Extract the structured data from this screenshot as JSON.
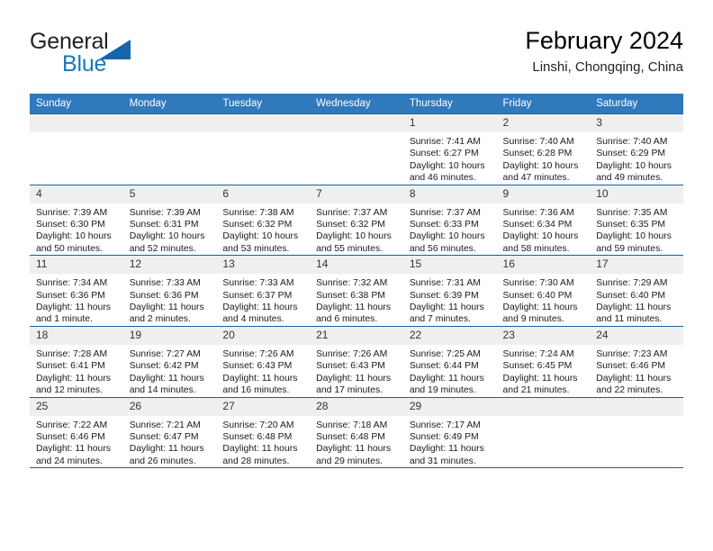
{
  "logo": {
    "word_top": "General",
    "word_bottom": "Blue",
    "triangle_color": "#1565ad",
    "blue_text_color": "#1878be"
  },
  "header": {
    "title": "February 2024",
    "subtitle": "Linshi, Chongqing, China"
  },
  "theme": {
    "header_blue": "#3079bd",
    "row_divider_blue": "#1b5fa0",
    "daynum_bg": "#efefef"
  },
  "calendar": {
    "weekday_headers": [
      "Sunday",
      "Monday",
      "Tuesday",
      "Wednesday",
      "Thursday",
      "Friday",
      "Saturday"
    ],
    "weeks": [
      [
        {
          "day": "",
          "sunrise": "",
          "sunset": "",
          "daylight_line1": "",
          "daylight_line2": "",
          "empty": true
        },
        {
          "day": "",
          "sunrise": "",
          "sunset": "",
          "daylight_line1": "",
          "daylight_line2": "",
          "empty": true
        },
        {
          "day": "",
          "sunrise": "",
          "sunset": "",
          "daylight_line1": "",
          "daylight_line2": "",
          "empty": true
        },
        {
          "day": "",
          "sunrise": "",
          "sunset": "",
          "daylight_line1": "",
          "daylight_line2": "",
          "empty": true
        },
        {
          "day": "1",
          "sunrise": "Sunrise: 7:41 AM",
          "sunset": "Sunset: 6:27 PM",
          "daylight_line1": "Daylight: 10 hours",
          "daylight_line2": "and 46 minutes."
        },
        {
          "day": "2",
          "sunrise": "Sunrise: 7:40 AM",
          "sunset": "Sunset: 6:28 PM",
          "daylight_line1": "Daylight: 10 hours",
          "daylight_line2": "and 47 minutes."
        },
        {
          "day": "3",
          "sunrise": "Sunrise: 7:40 AM",
          "sunset": "Sunset: 6:29 PM",
          "daylight_line1": "Daylight: 10 hours",
          "daylight_line2": "and 49 minutes."
        }
      ],
      [
        {
          "day": "4",
          "sunrise": "Sunrise: 7:39 AM",
          "sunset": "Sunset: 6:30 PM",
          "daylight_line1": "Daylight: 10 hours",
          "daylight_line2": "and 50 minutes."
        },
        {
          "day": "5",
          "sunrise": "Sunrise: 7:39 AM",
          "sunset": "Sunset: 6:31 PM",
          "daylight_line1": "Daylight: 10 hours",
          "daylight_line2": "and 52 minutes."
        },
        {
          "day": "6",
          "sunrise": "Sunrise: 7:38 AM",
          "sunset": "Sunset: 6:32 PM",
          "daylight_line1": "Daylight: 10 hours",
          "daylight_line2": "and 53 minutes."
        },
        {
          "day": "7",
          "sunrise": "Sunrise: 7:37 AM",
          "sunset": "Sunset: 6:32 PM",
          "daylight_line1": "Daylight: 10 hours",
          "daylight_line2": "and 55 minutes."
        },
        {
          "day": "8",
          "sunrise": "Sunrise: 7:37 AM",
          "sunset": "Sunset: 6:33 PM",
          "daylight_line1": "Daylight: 10 hours",
          "daylight_line2": "and 56 minutes."
        },
        {
          "day": "9",
          "sunrise": "Sunrise: 7:36 AM",
          "sunset": "Sunset: 6:34 PM",
          "daylight_line1": "Daylight: 10 hours",
          "daylight_line2": "and 58 minutes."
        },
        {
          "day": "10",
          "sunrise": "Sunrise: 7:35 AM",
          "sunset": "Sunset: 6:35 PM",
          "daylight_line1": "Daylight: 10 hours",
          "daylight_line2": "and 59 minutes."
        }
      ],
      [
        {
          "day": "11",
          "sunrise": "Sunrise: 7:34 AM",
          "sunset": "Sunset: 6:36 PM",
          "daylight_line1": "Daylight: 11 hours",
          "daylight_line2": "and 1 minute."
        },
        {
          "day": "12",
          "sunrise": "Sunrise: 7:33 AM",
          "sunset": "Sunset: 6:36 PM",
          "daylight_line1": "Daylight: 11 hours",
          "daylight_line2": "and 2 minutes."
        },
        {
          "day": "13",
          "sunrise": "Sunrise: 7:33 AM",
          "sunset": "Sunset: 6:37 PM",
          "daylight_line1": "Daylight: 11 hours",
          "daylight_line2": "and 4 minutes."
        },
        {
          "day": "14",
          "sunrise": "Sunrise: 7:32 AM",
          "sunset": "Sunset: 6:38 PM",
          "daylight_line1": "Daylight: 11 hours",
          "daylight_line2": "and 6 minutes."
        },
        {
          "day": "15",
          "sunrise": "Sunrise: 7:31 AM",
          "sunset": "Sunset: 6:39 PM",
          "daylight_line1": "Daylight: 11 hours",
          "daylight_line2": "and 7 minutes."
        },
        {
          "day": "16",
          "sunrise": "Sunrise: 7:30 AM",
          "sunset": "Sunset: 6:40 PM",
          "daylight_line1": "Daylight: 11 hours",
          "daylight_line2": "and 9 minutes."
        },
        {
          "day": "17",
          "sunrise": "Sunrise: 7:29 AM",
          "sunset": "Sunset: 6:40 PM",
          "daylight_line1": "Daylight: 11 hours",
          "daylight_line2": "and 11 minutes."
        }
      ],
      [
        {
          "day": "18",
          "sunrise": "Sunrise: 7:28 AM",
          "sunset": "Sunset: 6:41 PM",
          "daylight_line1": "Daylight: 11 hours",
          "daylight_line2": "and 12 minutes."
        },
        {
          "day": "19",
          "sunrise": "Sunrise: 7:27 AM",
          "sunset": "Sunset: 6:42 PM",
          "daylight_line1": "Daylight: 11 hours",
          "daylight_line2": "and 14 minutes."
        },
        {
          "day": "20",
          "sunrise": "Sunrise: 7:26 AM",
          "sunset": "Sunset: 6:43 PM",
          "daylight_line1": "Daylight: 11 hours",
          "daylight_line2": "and 16 minutes."
        },
        {
          "day": "21",
          "sunrise": "Sunrise: 7:26 AM",
          "sunset": "Sunset: 6:43 PM",
          "daylight_line1": "Daylight: 11 hours",
          "daylight_line2": "and 17 minutes."
        },
        {
          "day": "22",
          "sunrise": "Sunrise: 7:25 AM",
          "sunset": "Sunset: 6:44 PM",
          "daylight_line1": "Daylight: 11 hours",
          "daylight_line2": "and 19 minutes."
        },
        {
          "day": "23",
          "sunrise": "Sunrise: 7:24 AM",
          "sunset": "Sunset: 6:45 PM",
          "daylight_line1": "Daylight: 11 hours",
          "daylight_line2": "and 21 minutes."
        },
        {
          "day": "24",
          "sunrise": "Sunrise: 7:23 AM",
          "sunset": "Sunset: 6:46 PM",
          "daylight_line1": "Daylight: 11 hours",
          "daylight_line2": "and 22 minutes."
        }
      ],
      [
        {
          "day": "25",
          "sunrise": "Sunrise: 7:22 AM",
          "sunset": "Sunset: 6:46 PM",
          "daylight_line1": "Daylight: 11 hours",
          "daylight_line2": "and 24 minutes."
        },
        {
          "day": "26",
          "sunrise": "Sunrise: 7:21 AM",
          "sunset": "Sunset: 6:47 PM",
          "daylight_line1": "Daylight: 11 hours",
          "daylight_line2": "and 26 minutes."
        },
        {
          "day": "27",
          "sunrise": "Sunrise: 7:20 AM",
          "sunset": "Sunset: 6:48 PM",
          "daylight_line1": "Daylight: 11 hours",
          "daylight_line2": "and 28 minutes."
        },
        {
          "day": "28",
          "sunrise": "Sunrise: 7:18 AM",
          "sunset": "Sunset: 6:48 PM",
          "daylight_line1": "Daylight: 11 hours",
          "daylight_line2": "and 29 minutes."
        },
        {
          "day": "29",
          "sunrise": "Sunrise: 7:17 AM",
          "sunset": "Sunset: 6:49 PM",
          "daylight_line1": "Daylight: 11 hours",
          "daylight_line2": "and 31 minutes."
        },
        {
          "day": "",
          "sunrise": "",
          "sunset": "",
          "daylight_line1": "",
          "daylight_line2": "",
          "empty": true
        },
        {
          "day": "",
          "sunrise": "",
          "sunset": "",
          "daylight_line1": "",
          "daylight_line2": "",
          "empty": true
        }
      ]
    ]
  }
}
